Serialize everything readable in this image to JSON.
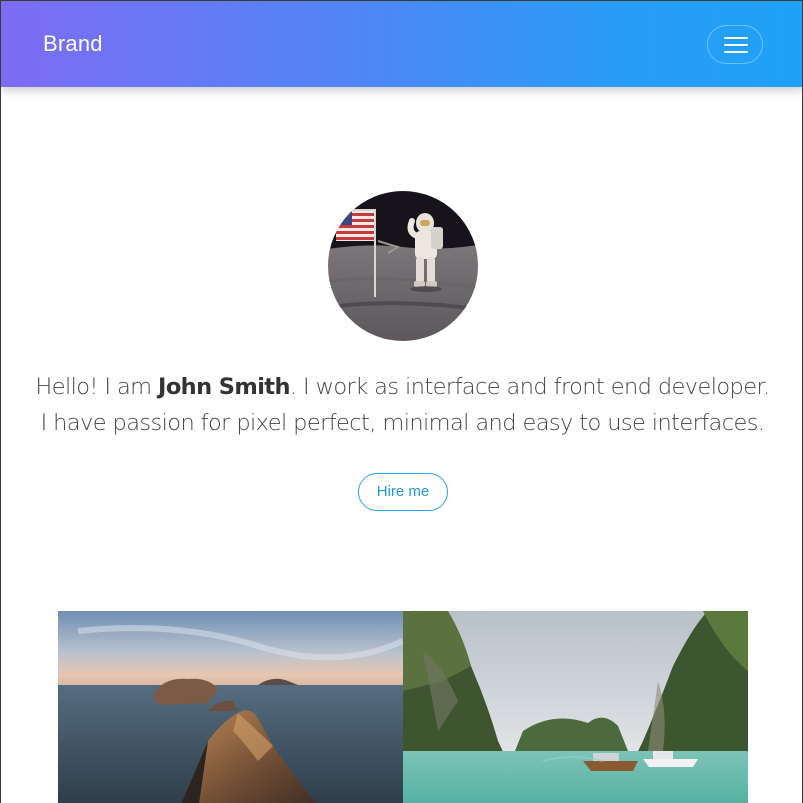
{
  "navbar": {
    "brand": "Brand",
    "menu_icon": "hamburger-icon"
  },
  "profile": {
    "avatar_alt": "astronaut-on-moon-photo",
    "intro_before_name": "Hello! I am ",
    "name": "John Smith",
    "intro_after_name": ". I work as interface and front end developer.",
    "intro_line2": "I have passion for pixel perfect, minimal and easy to use interfaces.",
    "cta_label": "Hire me"
  },
  "gallery": {
    "photos": [
      "coastal-rocks-photo",
      "tropical-bay-boats-photo"
    ]
  },
  "colors": {
    "gradient_start": "#7d6cf3",
    "gradient_end": "#1ea2f5",
    "accent": "#1e97d8"
  }
}
